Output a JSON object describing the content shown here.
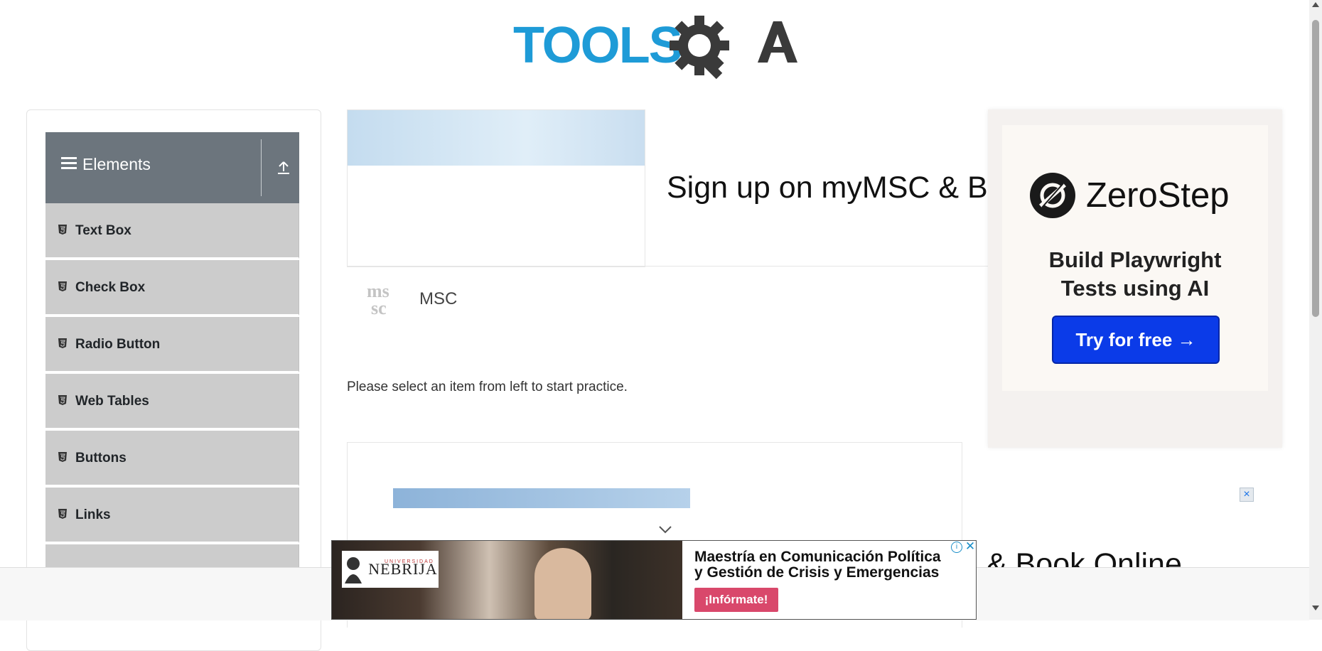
{
  "header": {
    "logo_text": "TOOLSQA",
    "logo_icon": "gear-magnifier-icon"
  },
  "sidebar": {
    "group_title": "Elements",
    "group_icon": "hamburger-icon",
    "collapse_icon": "upload-arrow-icon",
    "items": [
      {
        "label": "Text Box",
        "icon": "html5-icon"
      },
      {
        "label": "Check Box",
        "icon": "html5-icon"
      },
      {
        "label": "Radio Button",
        "icon": "html5-icon"
      },
      {
        "label": "Web Tables",
        "icon": "html5-icon"
      },
      {
        "label": "Buttons",
        "icon": "html5-icon"
      },
      {
        "label": "Links",
        "icon": "html5-icon"
      }
    ]
  },
  "ads": {
    "top": {
      "headline": "Sign up on myMSC & B",
      "advertiser": "MSC",
      "advertiser_logo_text": "msc"
    },
    "lower": {
      "headline": "& Book Online",
      "close_icon": "close-icon"
    },
    "right": {
      "brand": "ZeroStep",
      "tagline_line1": "Build Playwright",
      "tagline_line2": "Tests using AI",
      "cta": "Try for free →",
      "brand_color": "#0b3be8"
    },
    "banner": {
      "logo_small": "UNIVERSIDAD",
      "logo_text": "NEBRIJA",
      "text_line1": "Maestría en Comunicación Política",
      "text_line2": "y Gestión de Crisis y Emergencias",
      "cta": "¡Infórmate!",
      "cta_color": "#d9486b",
      "adchoice": "i",
      "close": "✕"
    }
  },
  "main": {
    "practice_text": "Please select an item from left to start practice."
  }
}
